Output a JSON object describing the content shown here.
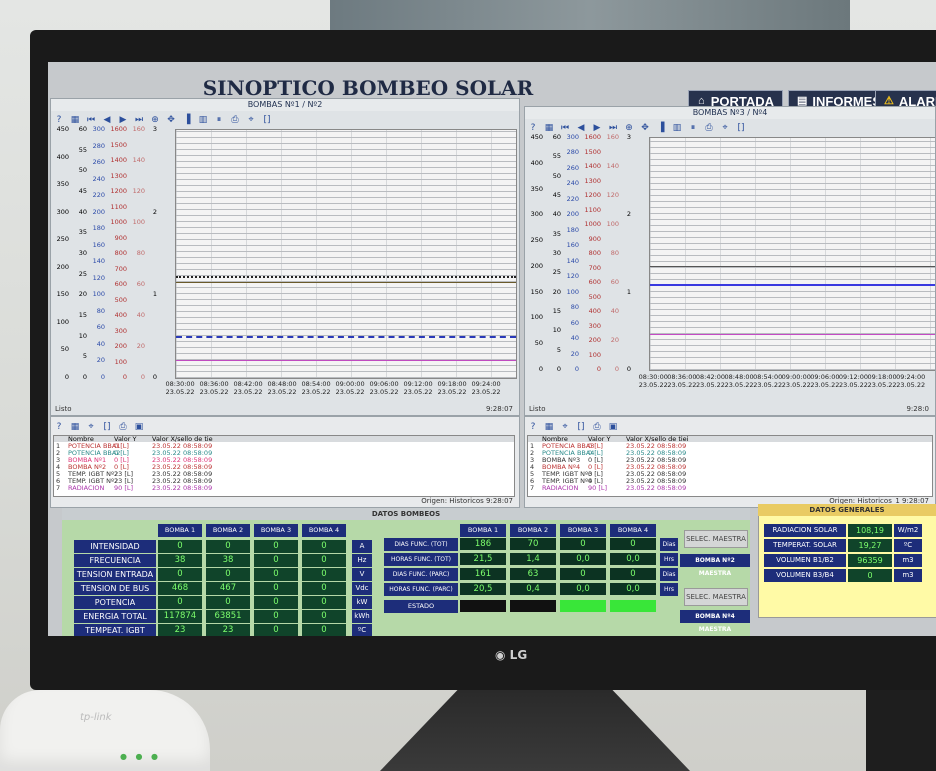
{
  "app_title": "SINOPTICO BOMBEO SOLAR",
  "nav": {
    "portada": "PORTADA",
    "informes": "INFORMES",
    "alarmas": "ALARM"
  },
  "left_chart": {
    "title": "BOMBAS Nº1 / Nº2",
    "axis1": [
      "450",
      "400",
      "350",
      "300",
      "250",
      "200",
      "150",
      "100",
      "50",
      "0"
    ],
    "axis2": [
      "60",
      "55",
      "50",
      "45",
      "40",
      "35",
      "30",
      "25",
      "20",
      "15",
      "10",
      "5",
      "0"
    ],
    "axis3": [
      "300",
      "280",
      "260",
      "240",
      "220",
      "200",
      "180",
      "160",
      "140",
      "120",
      "100",
      "80",
      "60",
      "40",
      "20",
      "0"
    ],
    "axis4": [
      "1600",
      "1500",
      "1400",
      "1300",
      "1200",
      "1100",
      "1000",
      "900",
      "800",
      "700",
      "600",
      "500",
      "400",
      "300",
      "200",
      "100",
      "0"
    ],
    "axis5": [
      "160",
      "140",
      "120",
      "100",
      "80",
      "60",
      "40",
      "20",
      "0"
    ],
    "axis6": [
      "3",
      "2",
      "1",
      "0"
    ],
    "x_times": [
      "08:30:00",
      "08:36:00",
      "08:42:00",
      "08:48:00",
      "08:54:00",
      "09:00:00",
      "09:06:00",
      "09:12:00",
      "09:18:00",
      "09:24:00"
    ],
    "x_dates": [
      "23.05.22",
      "23.05.22",
      "23.05.22",
      "23.05.22",
      "23.05.22",
      "23.05.22",
      "23.05.22",
      "23.05.22",
      "23.05.22",
      "23.05.22"
    ],
    "status_left": "Listo",
    "status_right": "9:28:07",
    "table_headers": [
      "Nombre",
      "Valor Y",
      "Valor X/sello de tie"
    ],
    "table_rows": [
      {
        "n": "1",
        "name": "POTENCIA BBA1",
        "val": "0 [L]",
        "ts": "23.05.22 08:58:09",
        "color": "#b33"
      },
      {
        "n": "2",
        "name": "POTENCIA BBA2",
        "val": "0 [L]",
        "ts": "23.05.22 08:58:09",
        "color": "#2a8a8a"
      },
      {
        "n": "3",
        "name": "BOMBA Nº1",
        "val": "0 [L]",
        "ts": "23.05.22 08:58:09",
        "color": "#d37"
      },
      {
        "n": "4",
        "name": "BOMBA Nº2",
        "val": "0 [L]",
        "ts": "23.05.22 08:58:09",
        "color": "#b33"
      },
      {
        "n": "5",
        "name": "TEMP. IGBT Nº2",
        "val": "23 [L]",
        "ts": "23.05.22 08:58:09",
        "color": "#333"
      },
      {
        "n": "6",
        "name": "TEMP. IGBT Nº2",
        "val": "23 [L]",
        "ts": "23.05.22 08:58:09",
        "color": "#333"
      },
      {
        "n": "7",
        "name": "RADIACION",
        "val": "90 [L]",
        "ts": "23.05.22 08:58:09",
        "color": "#a3a"
      }
    ],
    "origin": "Origen: Historicos  9:28:07"
  },
  "right_chart": {
    "title": "BOMBAS Nº3 / Nº4",
    "x_times": [
      "08:30:00",
      "08:36:00",
      "08:42:00",
      "08:48:00",
      "08:54:00",
      "09:00:00",
      "09:06:00",
      "09:12:00",
      "09:18:00",
      "09:24:00"
    ],
    "x_dates": [
      "23.05.22",
      "23.05.22",
      "23.05.22",
      "23.05.22",
      "23.05.22",
      "23.05.22",
      "23.05.22",
      "23.05.22",
      "23.05.22",
      "23.05.22"
    ],
    "status_left": "Listo",
    "status_right": "9:28:0",
    "table_headers": [
      "Nombre",
      "Valor Y",
      "Valor X/sello de tiei"
    ],
    "table_rows": [
      {
        "n": "1",
        "name": "POTENCIA BBA3",
        "val": "0 [L]",
        "ts": "23.05.22 08:58:09",
        "color": "#b33"
      },
      {
        "n": "2",
        "name": "POTENCIA BBA4",
        "val": "0 [L]",
        "ts": "23.05.22 08:58:09",
        "color": "#2a8a8a"
      },
      {
        "n": "3",
        "name": "BOMBA Nº3",
        "val": "0 [L]",
        "ts": "23.05.22 08:58:09",
        "color": "#333"
      },
      {
        "n": "4",
        "name": "BOMBA Nº4",
        "val": "0 [L]",
        "ts": "23.05.22 08:58:09",
        "color": "#b33"
      },
      {
        "n": "5",
        "name": "TEMP. IGBT Nº3",
        "val": "0 [L]",
        "ts": "23.05.22 08:58:09",
        "color": "#333"
      },
      {
        "n": "6",
        "name": "TEMP. IGBT Nº4",
        "val": "0 [L]",
        "ts": "23.05.22 08:58:09",
        "color": "#333"
      },
      {
        "n": "7",
        "name": "RADIACION",
        "val": "90 [L]",
        "ts": "23.05.22 08:58:09",
        "color": "#a3a"
      }
    ],
    "origin": "Origen: Historicos_1  9:28:07"
  },
  "datos_bombeos": {
    "title": "DATOS BOMBEOS",
    "pump_headers": [
      "BOMBA 1",
      "BOMBA 2",
      "BOMBA 3",
      "BOMBA 4"
    ],
    "rows": [
      {
        "label": "INTENSIDAD",
        "values": [
          "0",
          "0",
          "0",
          "0"
        ],
        "unit": "A"
      },
      {
        "label": "FRECUENCIA",
        "values": [
          "38",
          "38",
          "0",
          "0"
        ],
        "unit": "Hz"
      },
      {
        "label": "TENSION ENTRADA",
        "values": [
          "0",
          "0",
          "0",
          "0"
        ],
        "unit": "V"
      },
      {
        "label": "TENSION DE BUS",
        "values": [
          "468",
          "467",
          "0",
          "0"
        ],
        "unit": "Vdc"
      },
      {
        "label": "POTENCIA",
        "values": [
          "0",
          "0",
          "0",
          "0"
        ],
        "unit": "kW"
      },
      {
        "label": "ENERGIA TOTAL",
        "values": [
          "117874",
          "63851",
          "0",
          "0"
        ],
        "unit": "kWh"
      },
      {
        "label": "TEMPEAT. IGBT",
        "values": [
          "23",
          "23",
          "0",
          "0"
        ],
        "unit": "ºC"
      }
    ],
    "days_rows": [
      {
        "label": "DIAS FUNC. (TOT)",
        "values": [
          "186",
          "70",
          "0",
          "0"
        ],
        "unit": "Dias"
      },
      {
        "label": "HORAS FUNC. (TOT)",
        "values": [
          "21,5",
          "1,4",
          "0,0",
          "0,0"
        ],
        "unit": "Hrs"
      },
      {
        "label": "DIAS FUNC. (PARC)",
        "values": [
          "161",
          "63",
          "0",
          "0"
        ],
        "unit": "Dias"
      },
      {
        "label": "HORAS FUNC. (PARC)",
        "values": [
          "20,5",
          "0,4",
          "0,0",
          "0,0"
        ],
        "unit": "Hrs"
      }
    ],
    "estado_label": "ESTADO",
    "estado_colors": [
      "#111111",
      "#111111",
      "#39e639",
      "#39e639"
    ],
    "selec_maestra_1": "SELEC. MAESTRA",
    "maestra_1": "BOMBA Nº2 MAESTRA",
    "selec_maestra_2": "SELEC. MAESTRA",
    "maestra_2": "BOMBA Nº4 MAESTRA"
  },
  "datos_generales": {
    "title": "DATOS GENERALES",
    "rows": [
      {
        "label": "RADIACION SOLAR",
        "value": "108,19",
        "unit": "W/m2"
      },
      {
        "label": "TEMPERAT. SOLAR",
        "value": "19,27",
        "unit": "ºC"
      },
      {
        "label": "VOLUMEN B1/B2",
        "value": "96359",
        "unit": "m3"
      },
      {
        "label": "VOLUMEN B3/B4",
        "value": "0",
        "unit": "m3"
      }
    ]
  },
  "monitor_brand": "LG",
  "router_brand": "tp-link"
}
